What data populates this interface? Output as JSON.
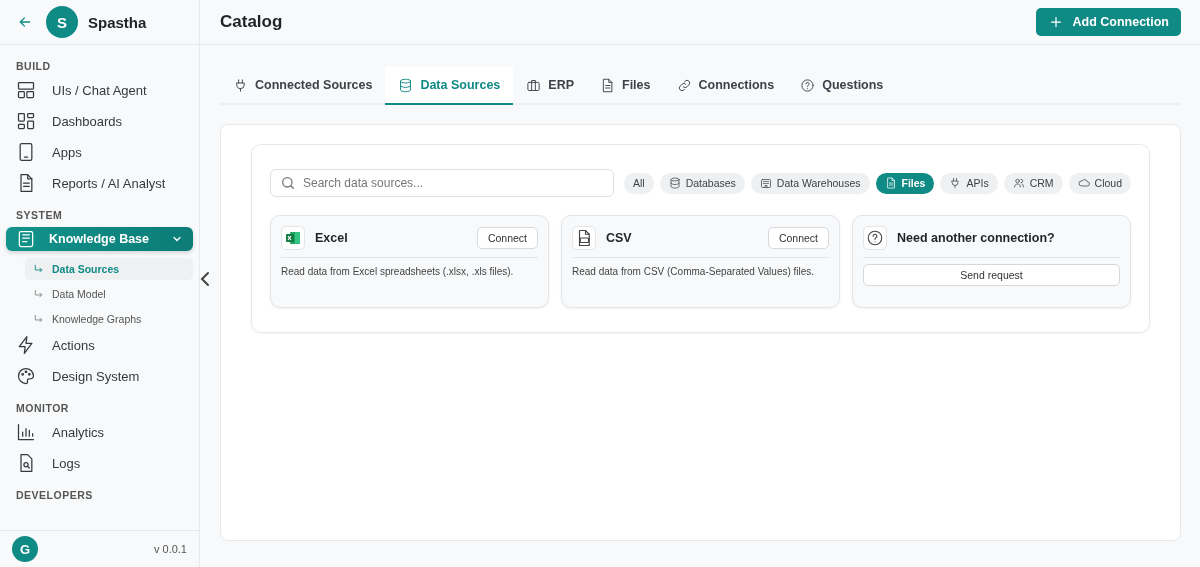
{
  "workspace": {
    "avatar": "S",
    "name": "Spastha"
  },
  "sidebar": {
    "sections": [
      {
        "title": "BUILD",
        "items": [
          {
            "label": "UIs / Chat Agent",
            "selected": false
          },
          {
            "label": "Dashboards",
            "selected": false
          },
          {
            "label": "Apps",
            "selected": false
          },
          {
            "label": "Reports / AI Analyst",
            "selected": false
          }
        ]
      },
      {
        "title": "SYSTEM",
        "items": [
          {
            "label": "Knowledge Base",
            "selected": true,
            "expanded": true,
            "children": [
              {
                "label": "Data Sources",
                "selected": true
              },
              {
                "label": "Data Model",
                "selected": false
              },
              {
                "label": "Knowledge Graphs",
                "selected": false
              }
            ]
          },
          {
            "label": "Actions",
            "selected": false
          },
          {
            "label": "Design System",
            "selected": false
          }
        ]
      },
      {
        "title": "MONITOR",
        "items": [
          {
            "label": "Analytics",
            "selected": false
          },
          {
            "label": "Logs",
            "selected": false
          }
        ]
      },
      {
        "title": "DEVELOPERS"
      }
    ]
  },
  "user": {
    "avatar": "G",
    "version": "v 0.0.1"
  },
  "page": {
    "title": "Catalog",
    "action": "Add Connection"
  },
  "tabs": [
    {
      "label": "Connected Sources",
      "selected": false
    },
    {
      "label": "Data Sources",
      "selected": true
    },
    {
      "label": "ERP",
      "selected": false
    },
    {
      "label": "Files",
      "selected": false
    },
    {
      "label": "Connections",
      "selected": false
    },
    {
      "label": "Questions",
      "selected": false
    }
  ],
  "search": {
    "placeholder": "Search data sources..."
  },
  "filters": [
    {
      "label": "All",
      "selected": false
    },
    {
      "label": "Databases",
      "selected": false
    },
    {
      "label": "Data Warehouses",
      "selected": false
    },
    {
      "label": "Files",
      "selected": true
    },
    {
      "label": "APIs",
      "selected": false
    },
    {
      "label": "CRM",
      "selected": false
    },
    {
      "label": "Cloud",
      "selected": false
    }
  ],
  "cards": [
    {
      "kind": "source",
      "title": "Excel",
      "button": "Connect",
      "description": "Read data from Excel spreadsheets (.xlsx, .xls files)."
    },
    {
      "kind": "source",
      "title": "CSV",
      "button": "Connect",
      "description": "Read data from CSV (Comma-Separated Values) files."
    },
    {
      "kind": "request",
      "title": "Need another connection?",
      "button": "Send request"
    }
  ]
}
